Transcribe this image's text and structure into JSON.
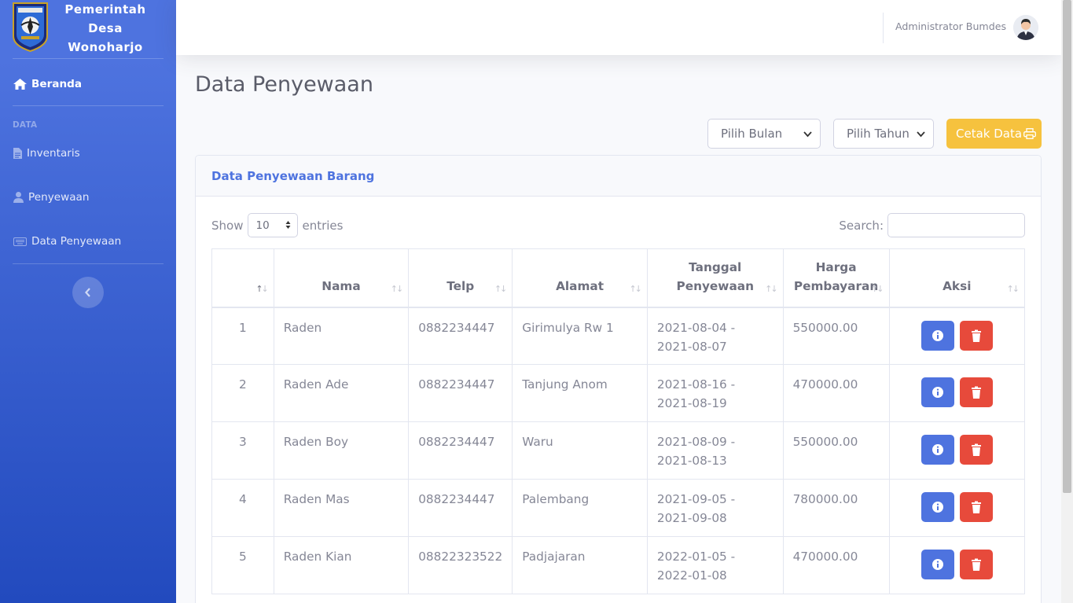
{
  "sidebar": {
    "brand_title": "Pemerintah Desa Wonoharjo",
    "items": [
      {
        "label": "Beranda",
        "icon": "home-icon",
        "active": true
      },
      {
        "label": "Inventaris",
        "icon": "file-icon"
      },
      {
        "label": "Penyewaan",
        "icon": "user-icon"
      },
      {
        "label": "Data Penyewaan",
        "icon": "keyboard-icon"
      }
    ],
    "heading": "DATA"
  },
  "topbar": {
    "user_name": "Administrator Bumdes"
  },
  "page": {
    "title": "Data Penyewaan",
    "month_select": "Pilih Bulan",
    "year_select": "Pilih Tahun",
    "print_button": "Cetak Data"
  },
  "card": {
    "title": "Data Penyewaan Barang",
    "show_label": "Show",
    "entries_value": "10",
    "entries_label": "entries",
    "search_label": "Search:"
  },
  "table": {
    "columns": [
      "",
      "Nama",
      "Telp",
      "Alamat",
      "Tanggal Penyewaan",
      "Harga Pembayaran",
      "Aksi"
    ],
    "rows": [
      {
        "no": "1",
        "nama": "Raden",
        "telp": "0882234447",
        "alamat": "Girimulya Rw 1",
        "tanggal": "2021-08-04 - 2021-08-07",
        "harga": "550000.00"
      },
      {
        "no": "2",
        "nama": "Raden Ade",
        "telp": "0882234447",
        "alamat": "Tanjung Anom",
        "tanggal": "2021-08-16 - 2021-08-19",
        "harga": "470000.00"
      },
      {
        "no": "3",
        "nama": "Raden Boy",
        "telp": "0882234447",
        "alamat": "Waru",
        "tanggal": "2021-08-09 - 2021-08-13",
        "harga": "550000.00"
      },
      {
        "no": "4",
        "nama": "Raden Mas",
        "telp": "0882234447",
        "alamat": "Palembang",
        "tanggal": "2021-09-05 - 2021-09-08",
        "harga": "780000.00"
      },
      {
        "no": "5",
        "nama": "Raden Kian",
        "telp": "08822323522",
        "alamat": "Padjajaran",
        "tanggal": "2022-01-05 - 2022-01-08",
        "harga": "470000.00"
      }
    ]
  },
  "colors": {
    "primary": "#4e73df",
    "warning": "#f6c23e",
    "danger": "#e74a3b"
  }
}
